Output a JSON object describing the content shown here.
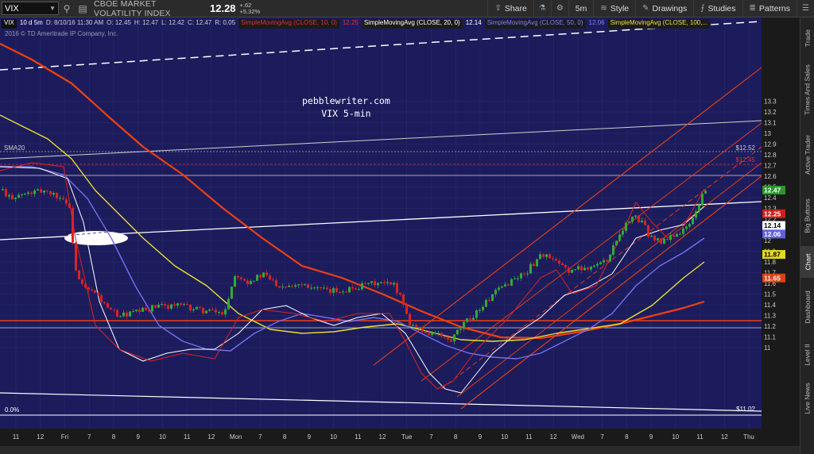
{
  "toolbar": {
    "symbol": "VIX",
    "description": "CBOE MARKET VOLATILITY INDEX",
    "last": "12.28",
    "change": "+.62",
    "change_pct": "+5.32%",
    "buttons": {
      "share": "Share",
      "interval": "5m",
      "style": "Style",
      "drawings": "Drawings",
      "studies": "Studies",
      "patterns": "Patterns"
    }
  },
  "info_line": {
    "period": "10 d 5m",
    "date": "D: 8/10/16 11:30 AM",
    "open": "O: 12.45",
    "high": "H: 12.47",
    "low": "L: 12.42",
    "close": "C: 12.47",
    "range": "R: 0.05",
    "ma10": "SimpleMovingAvg (CLOSE, 10, 0)",
    "ma10_val": "12.25",
    "ma20": "SimpleMovingAvg (CLOSE, 20, 0)",
    "ma20_val": "12.14",
    "ma50": "SimpleMovingAvg (CLOSE, 50, 0)",
    "ma50_val": "12.06",
    "ma100": "SimpleMovingAvg (CLOSE, 100,..."
  },
  "copyright": "2016 © TD Ameritrade IP Company, Inc.",
  "watermark": {
    "line1": "pebblewriter.com",
    "line2": "VIX 5-min"
  },
  "annotations": {
    "sma20": "SMA20",
    "fib_left": "0.0%",
    "fib_right": "$11.02",
    "level_1252": "$12.52",
    "level_1245": "$12.45"
  },
  "price_axis": {
    "ticks": [
      "13.3",
      "13.2",
      "13.1",
      "13",
      "12.9",
      "12.8",
      "12.7",
      "12.6",
      "12.5",
      "12.4",
      "12.3",
      "12.2",
      "12.1",
      "12",
      "11.9",
      "11.8",
      "11.7",
      "11.6",
      "11.5",
      "11.4",
      "11.3",
      "11.2",
      "11.1",
      "11"
    ],
    "badges": [
      {
        "value": "12.47",
        "bg": "#2a9a2a",
        "fg": "#ffffff"
      },
      {
        "value": "12.25",
        "bg": "#cc2020",
        "fg": "#ffffff"
      },
      {
        "value": "12.14",
        "bg": "#ffffff",
        "fg": "#000000"
      },
      {
        "value": "12.06",
        "bg": "#6060dd",
        "fg": "#ffffff"
      },
      {
        "value": "11.87",
        "bg": "#e6d820",
        "fg": "#000000"
      },
      {
        "value": "11.65",
        "bg": "#e04010",
        "fg": "#ffffff"
      }
    ]
  },
  "time_axis": [
    "11",
    "12",
    "Fri",
    "7",
    "8",
    "9",
    "10",
    "11",
    "12",
    "Mon",
    "7",
    "8",
    "9",
    "10",
    "11",
    "12",
    "Tue",
    "7",
    "8",
    "9",
    "10",
    "11",
    "12",
    "Wed",
    "7",
    "8",
    "9",
    "10",
    "11",
    "12",
    "Thu"
  ],
  "right_tabs": [
    "Trade",
    "Times And Sales",
    "Active Trader",
    "Big Buttons",
    "Chart",
    "Dashboard",
    "Level II",
    "Live News"
  ],
  "active_tab": "Chart",
  "colors": {
    "chart_bg": "#1c1c5c",
    "up": "#33aa33",
    "down": "#dd2222",
    "ma10": "#dd2222",
    "ma20": "#ffffff",
    "ma50": "#7070ee",
    "ma100": "#e8e030",
    "ma200": "#ee4010"
  }
}
